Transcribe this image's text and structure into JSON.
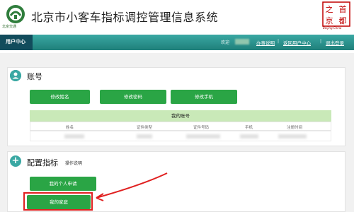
{
  "header": {
    "title": "北京市小客车指标调控管理信息系统",
    "logo_caption": "北京交通",
    "brand_chars": [
      "之",
      "首",
      "京",
      "都"
    ],
    "brand_caption": "Beijing China"
  },
  "nav": {
    "user_center": "用户中心",
    "welcome": "欢迎",
    "links": [
      "办事说明",
      "返回用户中心",
      "退出登录"
    ],
    "separator": "|"
  },
  "account": {
    "title": "账号",
    "buttons": [
      "修改姓名",
      "修改密码",
      "修改手机"
    ],
    "table_title": "我的账号",
    "columns": [
      "姓名",
      "证件类型",
      "证件号码",
      "手机",
      "注册时间"
    ]
  },
  "config": {
    "title": "配置指标",
    "subtitle": "操作说明",
    "buttons": [
      "我的个人申请",
      "我的家庭"
    ]
  },
  "colors": {
    "nav_teal": "#3aa8a3",
    "button_green": "#2aa545",
    "table_header": "#c9e9b8",
    "highlight_red": "#e02020"
  },
  "icons": [
    "beijing-transport-logo-icon",
    "capital-brand-seal-icon",
    "person-icon",
    "plus-icon",
    "arrow-icon"
  ]
}
